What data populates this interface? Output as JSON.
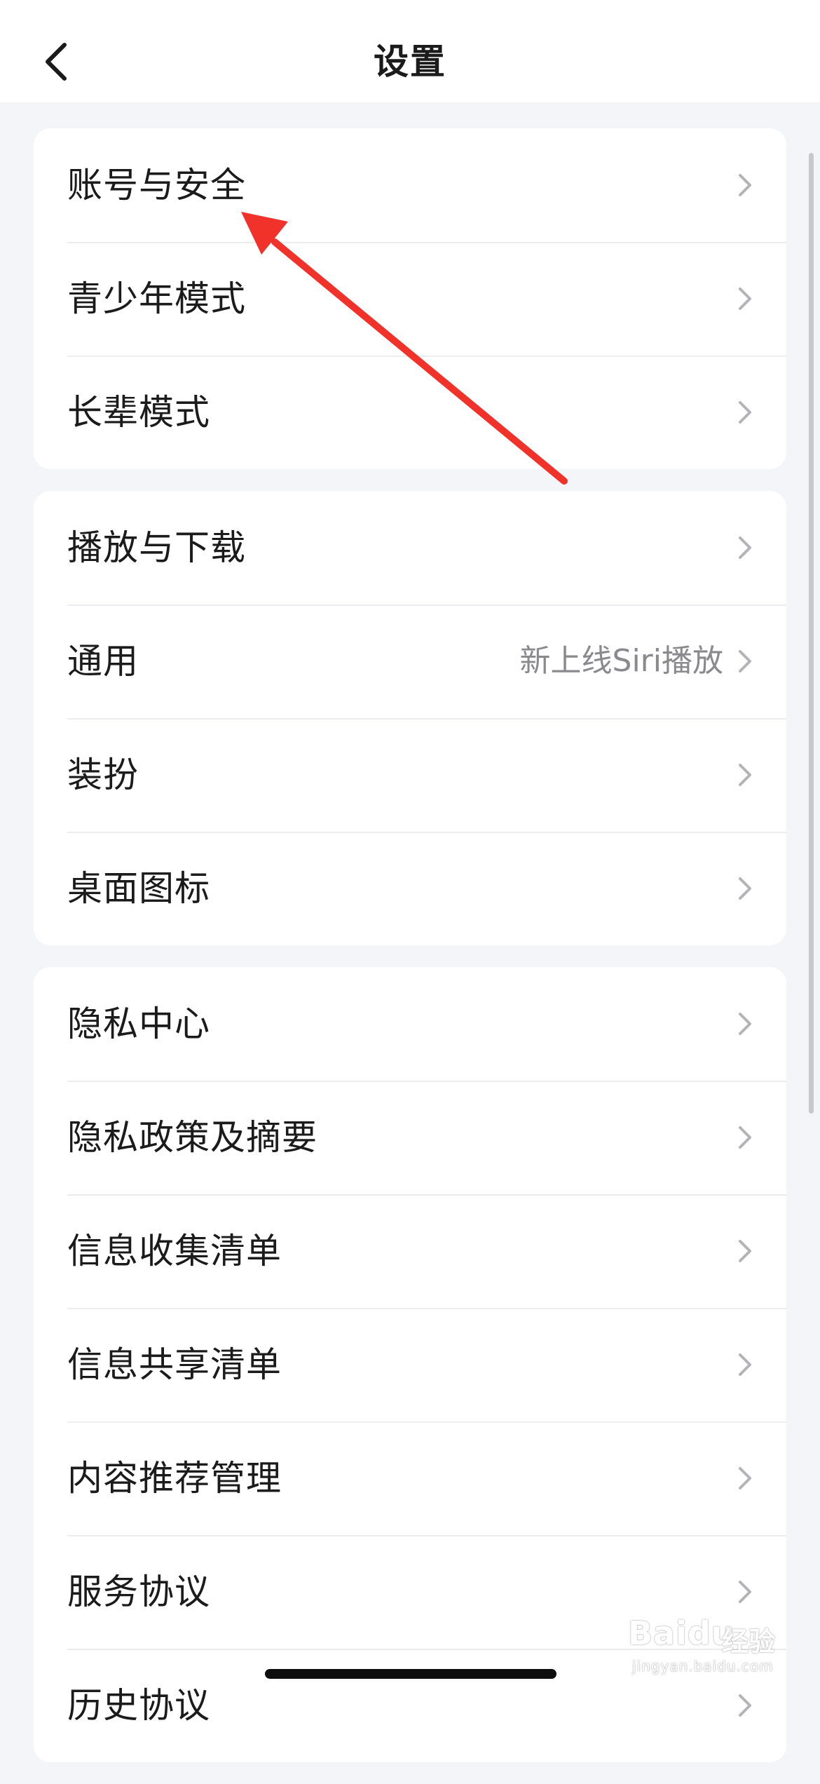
{
  "header": {
    "title": "设置",
    "back_icon": "chevron-left-icon"
  },
  "sections": [
    {
      "items": [
        {
          "label": "账号与安全",
          "icon": "chevron-right-icon"
        },
        {
          "label": "青少年模式",
          "icon": "chevron-right-icon"
        },
        {
          "label": "长辈模式",
          "icon": "chevron-right-icon"
        }
      ]
    },
    {
      "items": [
        {
          "label": "播放与下载",
          "icon": "chevron-right-icon"
        },
        {
          "label": "通用",
          "hint": "新上线Siri播放",
          "icon": "chevron-right-icon"
        },
        {
          "label": "装扮",
          "icon": "chevron-right-icon"
        },
        {
          "label": "桌面图标",
          "icon": "chevron-right-icon"
        }
      ]
    },
    {
      "items": [
        {
          "label": "隐私中心",
          "icon": "chevron-right-icon"
        },
        {
          "label": "隐私政策及摘要",
          "icon": "chevron-right-icon"
        },
        {
          "label": "信息收集清单",
          "icon": "chevron-right-icon"
        },
        {
          "label": "信息共享清单",
          "icon": "chevron-right-icon"
        },
        {
          "label": "内容推荐管理",
          "icon": "chevron-right-icon"
        },
        {
          "label": "服务协议",
          "icon": "chevron-right-icon"
        },
        {
          "label": "历史协议",
          "icon": "chevron-right-icon"
        }
      ]
    }
  ],
  "annotation": {
    "icon": "red-arrow-icon",
    "color": "#f0322b"
  },
  "watermark": {
    "brand": "Baidu",
    "cn": "经验",
    "url": "jingyan.baidu.com"
  },
  "colors": {
    "background": "#f4f5f9",
    "card": "#ffffff",
    "text": "#1b1b1b",
    "hint": "#8a8a8e",
    "chevron": "#b4b4b8"
  }
}
